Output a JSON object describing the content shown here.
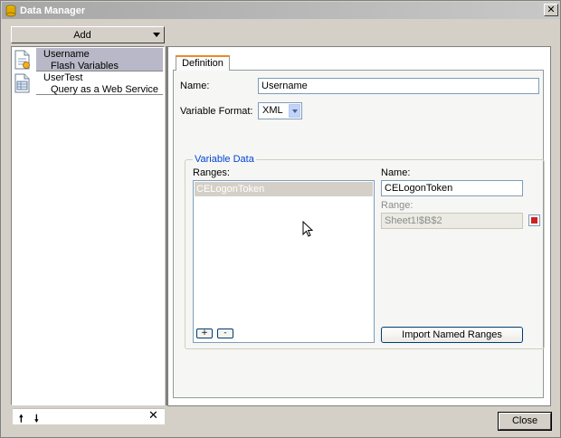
{
  "window": {
    "title": "Data Manager"
  },
  "left": {
    "add_label": "Add",
    "items": [
      {
        "name": "Username",
        "type": "Flash Variables",
        "selected": true
      },
      {
        "name": "UserTest",
        "type": "Query as a Web Service",
        "selected": false
      }
    ]
  },
  "tab": {
    "label": "Definition"
  },
  "form": {
    "name_label": "Name:",
    "name_value": "Username",
    "format_label": "Variable Format:",
    "format_value": "XML"
  },
  "variable_data": {
    "group_title": "Variable Data",
    "ranges_label": "Ranges:",
    "ranges": [
      "CELogonToken"
    ],
    "add_range": "+",
    "remove_range": "-",
    "name_label": "Name:",
    "name_value": "CELogonToken",
    "range_label": "Range:",
    "range_value": "Sheet1!$B$2",
    "import_label": "Import Named Ranges"
  },
  "footer": {
    "close_label": "Close"
  },
  "colors": {
    "selected_item": "#b8b8c8",
    "tab_accent": "#e68b2c",
    "group_title": "#0046d5"
  }
}
